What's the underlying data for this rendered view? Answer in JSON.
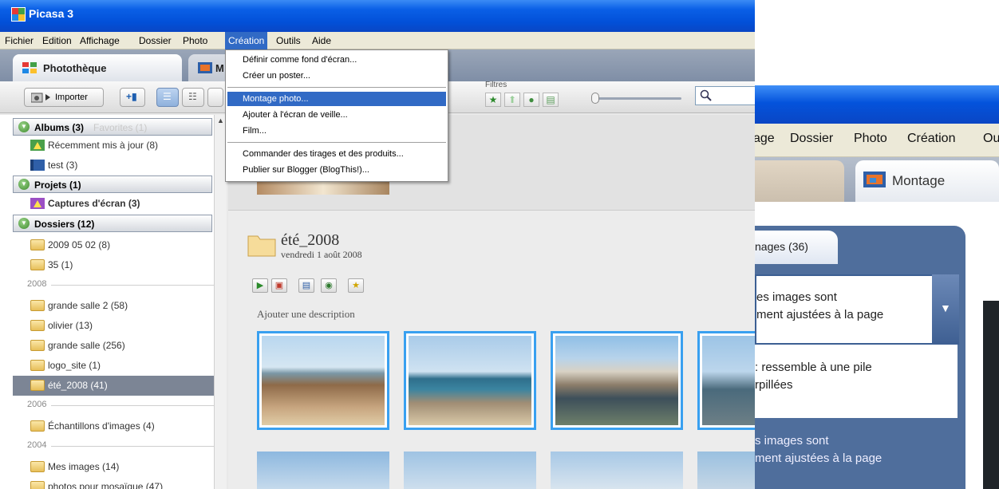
{
  "window": {
    "title": "Picasa 3"
  },
  "menubar": {
    "items": [
      "Fichier",
      "Edition",
      "Affichage",
      "Dossier",
      "Photo",
      "Création",
      "Outils",
      "Aide"
    ],
    "active": "Création"
  },
  "tabs": [
    {
      "label": "Photothèque",
      "icon": "library-icon"
    },
    {
      "label": "M",
      "icon": "montage-icon"
    }
  ],
  "toolbar": {
    "import_label": "Importer",
    "filters_label": "Filtres"
  },
  "creation_menu": {
    "items": [
      "Définir comme fond d'écran...",
      "Créer un poster...",
      "Montage photo...",
      "Ajouter à l'écran de veille...",
      "Film...",
      "Commander des tirages et des produits...",
      "Publier sur Blogger (BlogThis!)..."
    ],
    "highlighted": "Montage photo..."
  },
  "sidebar": {
    "albums": {
      "label": "Albums (3)",
      "ghost": "Favorites (1)",
      "items": [
        "Récemment mis à jour (8)",
        "test (3)"
      ]
    },
    "projets": {
      "label": "Projets (1)",
      "items": [
        "Captures d'écran (3)"
      ]
    },
    "dossiers": {
      "label": "Dossiers (12)",
      "items_top": [
        "2009 05 02 (8)",
        "35 (1)"
      ],
      "year_2008": "2008",
      "items_2008": [
        "grande salle 2 (58)",
        "olivier (13)",
        "grande salle (256)",
        "logo_site (1)",
        "été_2008 (41)"
      ],
      "selected": "été_2008 (41)",
      "year_2006": "2006",
      "items_2006": [
        "Échantillons d'images (4)"
      ],
      "year_2004": "2004",
      "items_2004": [
        "Mes images (14)",
        "photos pour mosaïque (47)"
      ]
    }
  },
  "content": {
    "folder_title": "été_2008",
    "folder_date": "vendredi 1 août 2008",
    "description_placeholder": "Ajouter une description"
  },
  "zoom_window": {
    "menu_items": [
      "age",
      "Dossier",
      "Photo",
      "Création",
      "Ou"
    ],
    "tab_label": "Montage",
    "panel_tab": "nages (36)",
    "dropdown_line1": "es images sont",
    "dropdown_line2": "ment ajustées à la page",
    "option1_line1": ": ressemble à une pile",
    "option1_line2": "rpillées",
    "option2_line1": "s images sont",
    "option2_line2": "ment ajustées à la page"
  },
  "colors": {
    "title_blue": "#0a5fe6",
    "menu_highlight": "#316ac5",
    "selection_gray": "#7c8595",
    "thumb_border": "#39a0f0"
  }
}
